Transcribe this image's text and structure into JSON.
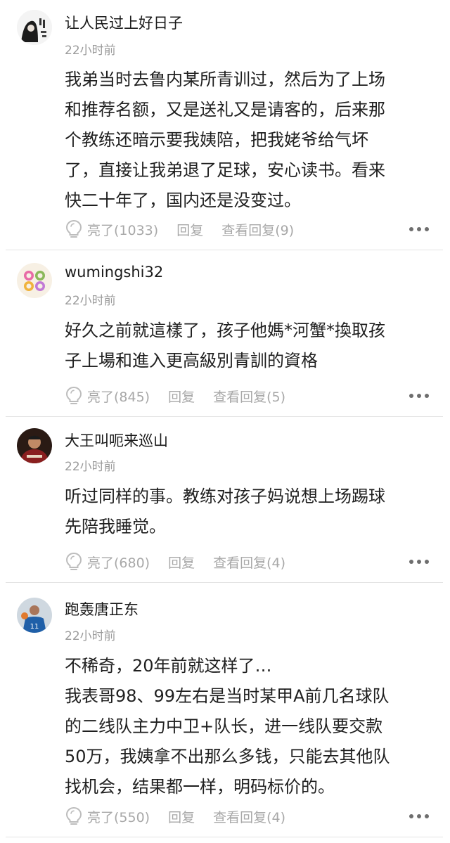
{
  "comments": [
    {
      "username": "让人民过上好日子",
      "time": "22小时前",
      "lines": [
        "我弟当时去鲁内某所青训过，然后为了上场",
        "和推荐名额，又是送礼又是请客的，后来那",
        "个教练还暗示要我姨陪，把我姥爷给气坏",
        "了，直接让我弟退了足球，安心读书。看来",
        "快二十年了，国内还是没变过。"
      ],
      "like_label": "亮了(1033)",
      "reply_label": "回复",
      "view_replies_label": "查看回复(9)"
    },
    {
      "username": "wumingshi32",
      "time": "22小时前",
      "lines": [
        "好久之前就這樣了，孩子他媽*河蟹*換取孩",
        "子上場和進入更高級別青訓的資格"
      ],
      "like_label": "亮了(845)",
      "reply_label": "回复",
      "view_replies_label": "查看回复(5)"
    },
    {
      "username": "大王叫呃来巡山",
      "time": "22小时前",
      "lines": [
        "听过同样的事。教练对孩子妈说想上场踢球",
        "先陪我睡觉。"
      ],
      "like_label": "亮了(680)",
      "reply_label": "回复",
      "view_replies_label": "查看回复(4)"
    },
    {
      "username": "跑轰唐正东",
      "time": "22小时前",
      "lines": [
        "不稀奇，20年前就这样了…",
        "我表哥98、99左右是当时某甲A前几名球队",
        "的二线队主力中卫+队长，进一线队要交款",
        "50万，我姨拿不出那么多钱，只能去其他队",
        "找机会，结果都一样，明码标价的。"
      ],
      "like_label": "亮了(550)",
      "reply_label": "回复",
      "view_replies_label": "查看回复(4)"
    }
  ],
  "icons": {
    "like": "lightbulb-icon",
    "more": "more-dots-icon"
  },
  "colors": {
    "meta_gray": "#9b9b9b",
    "action_gray": "#a8a8a8",
    "text": "#1f1f1f",
    "divider": "#e4e4e4"
  }
}
